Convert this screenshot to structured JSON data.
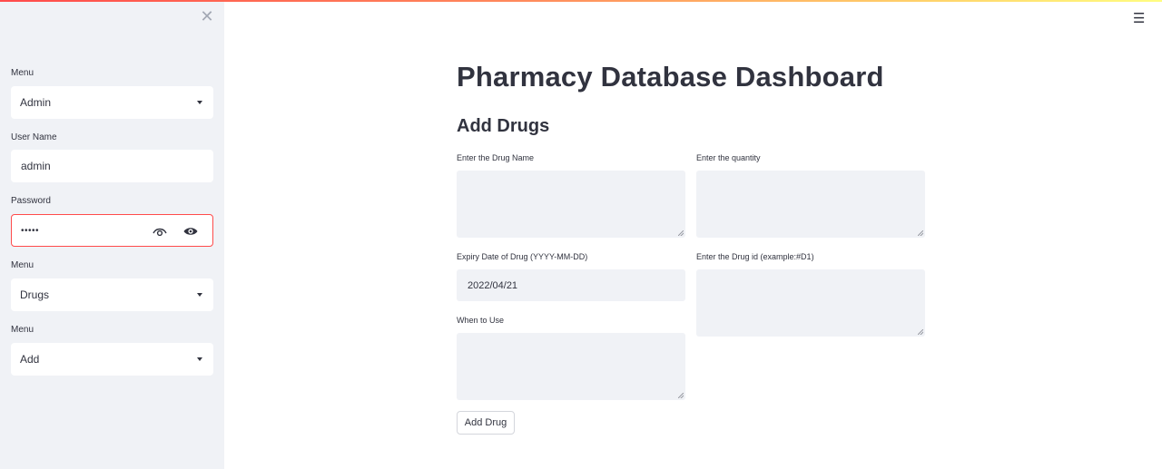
{
  "sidebar": {
    "close_icon": "close-icon",
    "menu1": {
      "label": "Menu",
      "selected": "Admin"
    },
    "username": {
      "label": "User Name",
      "value": "admin"
    },
    "password": {
      "label": "Password",
      "value": "•••••",
      "border_color": "#ff4b4b"
    },
    "menu2": {
      "label": "Menu",
      "selected": "Drugs"
    },
    "menu3": {
      "label": "Menu",
      "selected": "Add"
    }
  },
  "header": {
    "menu_icon": "hamburger-icon",
    "menu_glyph": "☰"
  },
  "main": {
    "title": "Pharmacy Database Dashboard",
    "subtitle": "Add Drugs",
    "fields": {
      "drug_name": {
        "label": "Enter the Drug Name",
        "value": ""
      },
      "quantity": {
        "label": "Enter the quantity",
        "value": ""
      },
      "expiry": {
        "label": "Expiry Date of Drug (YYYY-MM-DD)",
        "value": "2022/04/21"
      },
      "drug_id": {
        "label": "Enter the Drug id (example:#D1)",
        "value": ""
      },
      "when_to_use": {
        "label": "When to Use",
        "value": ""
      }
    },
    "submit_label": "Add Drug"
  },
  "colors": {
    "sidebar_bg": "#f0f2f6",
    "accent": "#ff4b4b",
    "text": "#31333f",
    "input_bg": "#f0f2f6"
  }
}
